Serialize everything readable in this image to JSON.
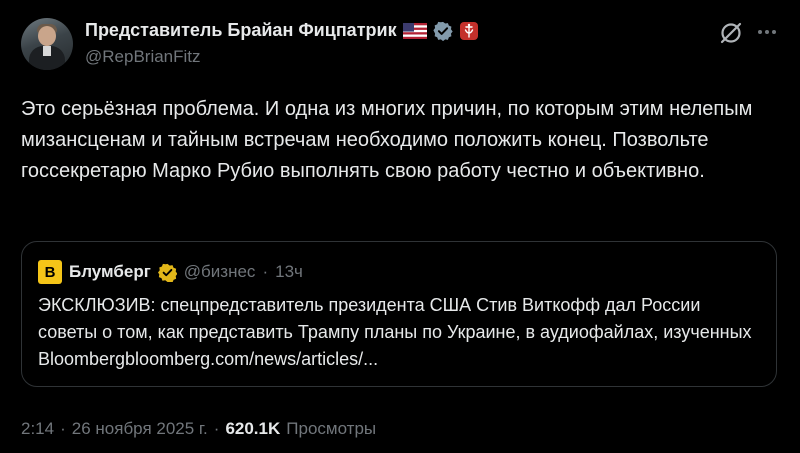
{
  "author": {
    "name": "Представитель Брайан Фицпатрик",
    "handle": "@RepBrianFitz",
    "flag_icon": "us-flag-icon",
    "verified_icon": "verified-badge-icon",
    "gov_badge_icon": "house-seal-icon"
  },
  "actions": {
    "grok_icon": "grok-icon",
    "more_icon": "more-options-icon"
  },
  "tweet": {
    "text": "Это серьёзная проблема. И одна из многих причин, по которым этим нелепым мизансценам и тайным встречам необходимо положить конец. Позвольте госсекретарю Марко Рубио выполнять свою работу честно и объективно."
  },
  "quote": {
    "logo_letter": "B",
    "name": "Блумберг",
    "handle": "@бизнес",
    "dot": "·",
    "time": "13ч",
    "text": "ЭКСКЛЮЗИВ: спецпредставитель президента США Стив Виткофф дал России советы о том, как представить Трампу планы по Украине, в аудиофайлах, изученных Bloombergbloomberg.com/news/articles/...",
    "colors": {
      "logo_bg": "#f5c518",
      "verified": "#e2b719"
    }
  },
  "meta": {
    "time": "2:14",
    "sep1": "·",
    "date": "26 ноября 2025 г.",
    "sep2": "·",
    "views_count": "620.1K",
    "views_label": "Просмотры"
  },
  "colors": {
    "background": "#000000",
    "text": "#e7e9ea",
    "muted": "#71767b",
    "verified_badge": "#829aab",
    "gov_badge": "#c4302b"
  }
}
